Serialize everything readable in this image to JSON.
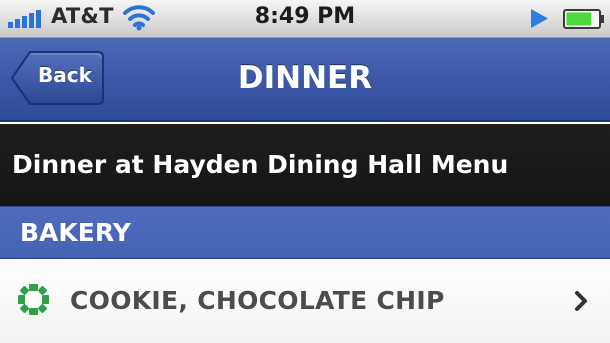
{
  "status_bar": {
    "carrier": "AT&T",
    "time": "8:49 PM",
    "signal_icon": "signal-bars-icon",
    "wifi_icon": "wifi-icon",
    "play_icon": "play-icon",
    "battery_icon": "battery-icon",
    "battery_level": 0.8
  },
  "nav_bar": {
    "back_label": "Back",
    "title": "DINNER"
  },
  "sub_header": {
    "title": "Dinner at Hayden Dining Hall Menu"
  },
  "section": {
    "title": "BAKERY"
  },
  "items": [
    {
      "label": "COOKIE, CHOCOLATE CHIP",
      "icon": "veggie-badge-icon",
      "accessory_icon": "chevron-right-icon"
    }
  ],
  "colors": {
    "nav_bar": "#3c58a8",
    "section_header": "#4a67b9",
    "sub_header": "#1a1a1a",
    "battery_fill": "#4cd93c",
    "play_icon": "#2f7ddf",
    "item_icon": "#2ea04a"
  }
}
